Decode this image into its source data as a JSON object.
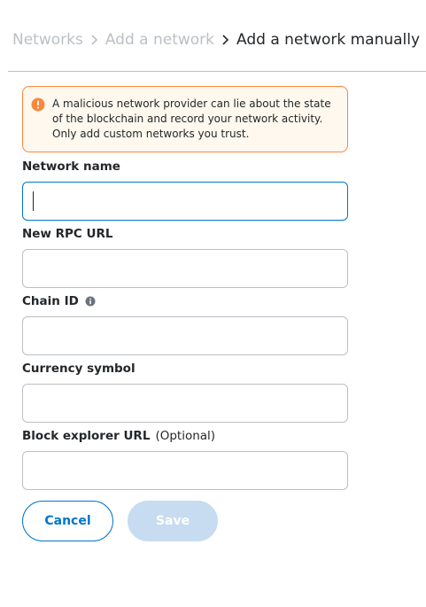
{
  "breadcrumb": {
    "items": [
      {
        "label": "Networks"
      },
      {
        "label": "Add a network"
      }
    ],
    "current": "Add a network manually"
  },
  "warning": {
    "icon": "warning-icon",
    "text": "A malicious network provider can lie about the state of the blockchain and record your network activity. Only add custom networks you trust.",
    "accent_color": "#f8883b"
  },
  "form": {
    "network_name": {
      "label": "Network name",
      "value": ""
    },
    "rpc_url": {
      "label": "New RPC URL",
      "value": ""
    },
    "chain_id": {
      "label": "Chain ID",
      "value": "",
      "icon": "info-icon"
    },
    "currency_symbol": {
      "label": "Currency symbol",
      "value": ""
    },
    "block_explorer": {
      "label": "Block explorer URL",
      "optional": "(Optional)",
      "value": ""
    }
  },
  "actions": {
    "cancel_label": "Cancel",
    "save_label": "Save",
    "primary_color": "#0376c9"
  }
}
